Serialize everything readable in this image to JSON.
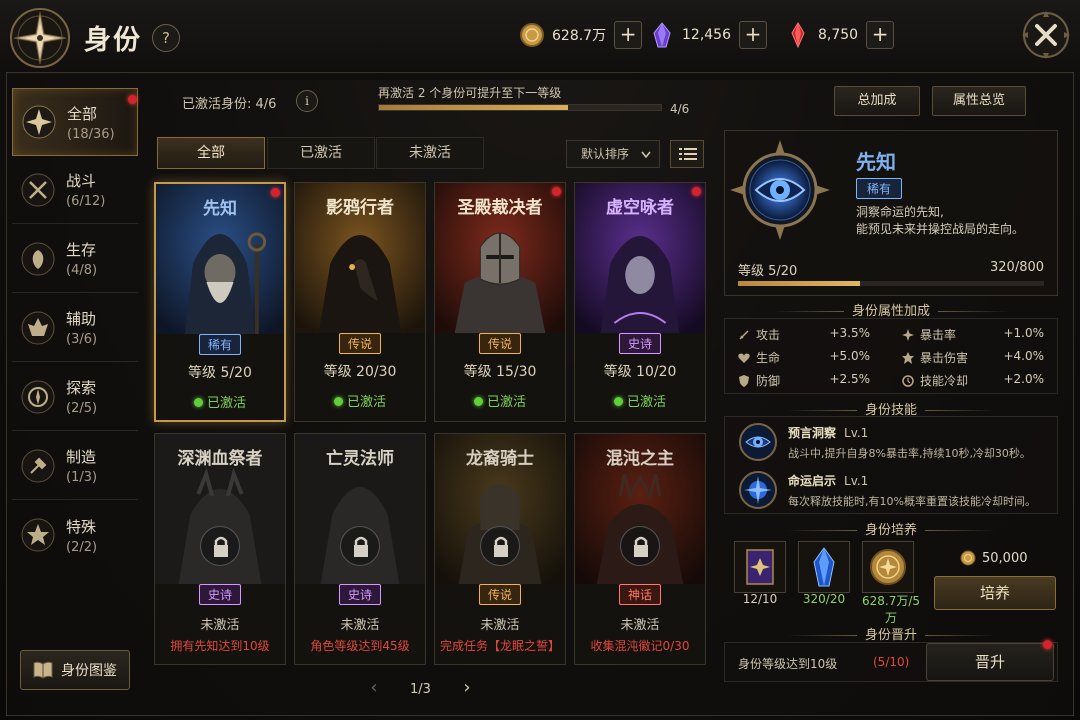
{
  "header": {
    "title": "身份",
    "help_label": "?",
    "currencies": [
      {
        "icon": "gold-coin-icon",
        "amount": "628.7万"
      },
      {
        "icon": "purple-crystal-icon",
        "amount": "12,456"
      },
      {
        "icon": "red-crystal-icon",
        "amount": "8,750"
      }
    ],
    "plus_label": "+"
  },
  "sidebar": {
    "items": [
      {
        "name": "全部",
        "count": "(18/36)",
        "active": true,
        "badge": true
      },
      {
        "name": "战斗",
        "count": "(6/12)"
      },
      {
        "name": "生存",
        "count": "(4/8)"
      },
      {
        "name": "辅助",
        "count": "(3/6)"
      },
      {
        "name": "探索",
        "count": "(2/5)"
      },
      {
        "name": "制造",
        "count": "(1/3)"
      },
      {
        "name": "特殊",
        "count": "(2/2)"
      }
    ],
    "compendium_label": "身份图鉴"
  },
  "summary": {
    "activated_label": "已激活身份: 4/6",
    "info_label": "i",
    "progress_label": "再激活 2 个身份可提升至下一等级",
    "progress_count": "4/6",
    "progress_fraction": 0.67,
    "total_bonus_label": "总加成",
    "attr_overview_label": "属性总览"
  },
  "filters": {
    "tabs": [
      "全部",
      "已激活",
      "未激活"
    ],
    "active_tab": 0,
    "sort_label": "默认排序"
  },
  "cards": [
    {
      "name": "先知",
      "rarity": "稀有",
      "rarity_class": "r-rare",
      "level": "等级  5/20",
      "status": "已激活",
      "selected": true,
      "badge": true
    },
    {
      "name": "影鸦行者",
      "rarity": "传说",
      "rarity_class": "r-leg",
      "level": "等级  20/30",
      "status": "已激活"
    },
    {
      "name": "圣殿裁决者",
      "rarity": "传说",
      "rarity_class": "r-leg",
      "level": "等级  15/30",
      "status": "已激活",
      "badge": true
    },
    {
      "name": "虚空咏者",
      "rarity": "史诗",
      "rarity_class": "r-epic",
      "level": "等级  10/20",
      "status": "已激活",
      "badge": true
    },
    {
      "name": "深渊血祭者",
      "rarity": "史诗",
      "rarity_class": "r-epic",
      "state": "未激活",
      "req": "拥有先知达到10级"
    },
    {
      "name": "亡灵法师",
      "rarity": "史诗",
      "rarity_class": "r-epic",
      "state": "未激活",
      "req": "角色等级达到45级"
    },
    {
      "name": "龙裔骑士",
      "rarity": "传说",
      "rarity_class": "r-leg",
      "state": "未激活",
      "req": "完成任务【龙眠之誓】"
    },
    {
      "name": "混沌之主",
      "rarity": "神话",
      "rarity_class": "r-myth",
      "state": "未激活",
      "req": "收集混沌徽记0/30"
    }
  ],
  "pager": {
    "prev": "‹",
    "text": "1/3",
    "next": "›"
  },
  "detail": {
    "name": "先知",
    "rarity": "稀有",
    "desc1": "洞察命运的先知,",
    "desc2": "能预见未来并操控战局的走向。",
    "level_label": "等级  5/20",
    "exp": "320/800",
    "exp_fraction": 0.4,
    "attr_title": "身份属性加成",
    "attrs": [
      {
        "label": "攻击",
        "value": "+3.5%",
        "icon": "sword-icon"
      },
      {
        "label": "暴击率",
        "value": "+1.0%",
        "icon": "crit-rate-icon"
      },
      {
        "label": "生命",
        "value": "+5.0%",
        "icon": "heart-icon"
      },
      {
        "label": "暴击伤害",
        "value": "+4.0%",
        "icon": "crit-damage-icon"
      },
      {
        "label": "防御",
        "value": "+2.5%",
        "icon": "shield-icon"
      },
      {
        "label": "技能冷却",
        "value": "+2.0%",
        "icon": "cooldown-icon"
      }
    ],
    "skill_title": "身份技能",
    "skills": [
      {
        "name": "预言洞察",
        "lv": "Lv.1",
        "desc": "战斗中,提升自身8%暴击率,持续10秒,冷却30秒。"
      },
      {
        "name": "命运启示",
        "lv": "Lv.1",
        "desc": "每次释放技能时,有10%概率重置该技能冷却时间。"
      }
    ],
    "train_title": "身份培养",
    "materials": [
      {
        "icon": "tome-icon",
        "count": "12/10",
        "color": "#e4dac6"
      },
      {
        "icon": "blue-crystal-icon",
        "count": "320/20",
        "color": "#8fd46a"
      },
      {
        "icon": "gold-coin-icon",
        "count": "628.7万/5万",
        "color": "#8fd46a"
      }
    ],
    "train_cost": "50,000",
    "train_label": "培养",
    "promote_title": "身份晋升",
    "promote_req": "身份等级达到10级",
    "promote_progress": "(5/10)",
    "promote_label": "晋升"
  }
}
